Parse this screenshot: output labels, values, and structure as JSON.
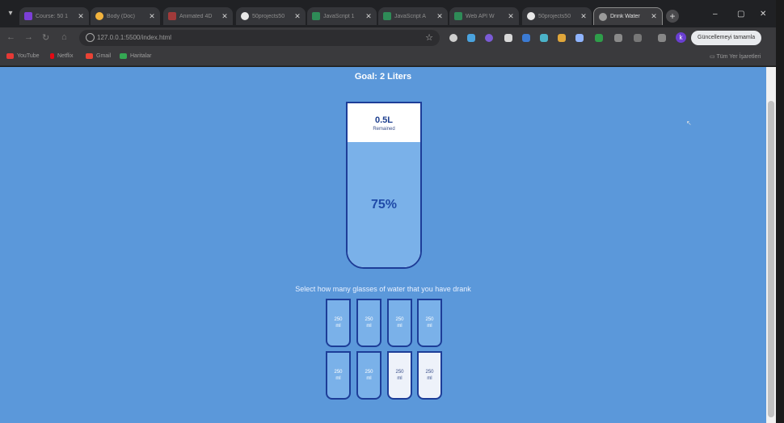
{
  "browser": {
    "tabs": [
      {
        "title": "Course: 50 1",
        "favicon_color": "#7b3fd6",
        "active": false
      },
      {
        "title": "Body (Doc)",
        "favicon_color": "#f2b33d",
        "active": false
      },
      {
        "title": "Animated 4D",
        "favicon_color": "#a13a3a",
        "active": false
      },
      {
        "title": "50projects50",
        "favicon_color": "#e8e8e8",
        "active": false
      },
      {
        "title": "JavaScript 1",
        "favicon_color": "#2e8b57",
        "active": false
      },
      {
        "title": "JavaScript A",
        "favicon_color": "#2e8b57",
        "active": false
      },
      {
        "title": "Web API W",
        "favicon_color": "#2e8b57",
        "active": false
      },
      {
        "title": "50projects50",
        "favicon_color": "#e8e8e8",
        "active": false
      },
      {
        "title": "Drink Water",
        "favicon_color": "#9a9a9a",
        "active": true
      }
    ],
    "new_tab_label": "+",
    "window_controls": {
      "minimize": "–",
      "restore": "▢",
      "close": "✕"
    },
    "url": "127.0.0.1:5500/index.html",
    "update_button": "Güncellemeyi tamamla",
    "profile_initial": "k",
    "bookmarks": [
      {
        "label": "YouTube",
        "color": "#e53935"
      },
      {
        "label": "Netflix",
        "color": "#e50914"
      },
      {
        "label": "Gmail",
        "color": "#ea4335"
      },
      {
        "label": "Haritalar",
        "color": "#34a853"
      }
    ],
    "all_bookmarks_label": "Tüm Yer İşaretleri"
  },
  "app": {
    "goal": "Goal: 2 Liters",
    "remained_value": "0.5L",
    "remained_label": "Remained",
    "percentage": "75%",
    "fill_fraction": 0.75,
    "instruction": "Select how many glasses of water that you have drank",
    "glasses": [
      {
        "line1": "250",
        "line2": "ml",
        "full": true
      },
      {
        "line1": "250",
        "line2": "ml",
        "full": true
      },
      {
        "line1": "250",
        "line2": "ml",
        "full": true
      },
      {
        "line1": "250",
        "line2": "ml",
        "full": true
      },
      {
        "line1": "250",
        "line2": "ml",
        "full": true
      },
      {
        "line1": "250",
        "line2": "ml",
        "full": true
      },
      {
        "line1": "250",
        "line2": "ml",
        "full": false
      },
      {
        "line1": "250",
        "line2": "ml",
        "full": false
      }
    ]
  }
}
